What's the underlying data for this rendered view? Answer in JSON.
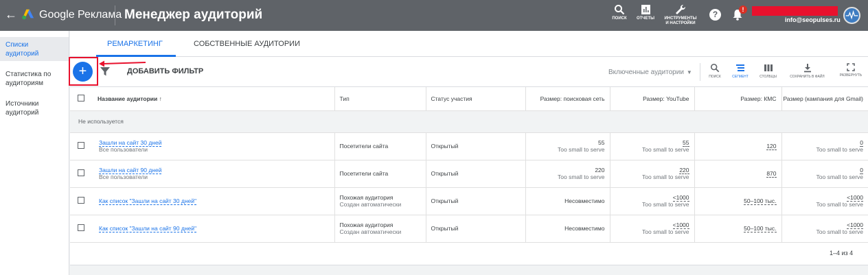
{
  "header": {
    "back_icon": "arrow-left-icon",
    "brand": "Google Реклама",
    "page_title": "Менеджер аудиторий",
    "search_label": "ПОИСК",
    "reports_label": "ОТЧЕТЫ",
    "tools_label_1": "ИНСТРУМЕНТЫ",
    "tools_label_2": "И НАСТРОЙКИ",
    "help_glyph": "?",
    "notification_badge": "!",
    "email": "info@seopulses.ru"
  },
  "sidebar": {
    "items": [
      {
        "label": "Списки аудиторий",
        "active": true
      },
      {
        "label": "Статистика по аудиториям",
        "active": false
      },
      {
        "label": "Источники аудиторий",
        "active": false
      }
    ]
  },
  "tabs": [
    {
      "label": "РЕМАРКЕТИНГ",
      "active": true
    },
    {
      "label": "СОБСТВЕННЫЕ АУДИТОРИИ",
      "active": false
    }
  ],
  "toolbar": {
    "add_glyph": "+",
    "add_filter": "ДОБАВИТЬ ФИЛЬТР",
    "included": "Включенные аудитории",
    "tools": {
      "search": "ПОИСК",
      "segment": "СЕГМЕНТ",
      "columns": "СТОЛБЦЫ",
      "save": "СОХРАНИТЬ В ФАЙЛ",
      "expand": "РАЗВЕРНУТЬ"
    }
  },
  "table": {
    "headers": {
      "name": "Название аудитории",
      "type": "Тип",
      "status": "Статус участия",
      "search": "Размер: поисковая сеть",
      "youtube": "Размер: YouTube",
      "kms": "Размер: КМС",
      "gmail": "Размер (кампания для Gmail)"
    },
    "group": "Не используется",
    "rows": [
      {
        "name": "Зашли на сайт 30 дней",
        "sub": "Все пользователи",
        "type": "Посетители сайта",
        "type_sub": "",
        "status": "Открытый",
        "search_val": "55",
        "search_sub": "Too small to serve",
        "yt_val": "55",
        "yt_sub": "Too small to serve",
        "kms_val": "120",
        "gmail_val": "0",
        "gmail_sub": "Too small to serve"
      },
      {
        "name": "Зашли на сайт 90 дней",
        "sub": "Все пользователи",
        "type": "Посетители сайта",
        "type_sub": "",
        "status": "Открытый",
        "search_val": "220",
        "search_sub": "Too small to serve",
        "yt_val": "220",
        "yt_sub": "Too small to serve",
        "kms_val": "870",
        "gmail_val": "0",
        "gmail_sub": "Too small to serve"
      },
      {
        "name": "Как список \"Зашли на сайт 30 дней\"",
        "sub": "",
        "type": "Похожая аудитория",
        "type_sub": "Создан автоматически",
        "status": "Открытый",
        "search_val": "Несовместимо",
        "search_sub": "",
        "yt_val": "<1000",
        "yt_sub": "Too small to serve",
        "kms_val": "50–100 тыс.",
        "gmail_val": "<1000",
        "gmail_sub": "Too small to serve"
      },
      {
        "name": "Как список \"Зашли на сайт 90 дней\"",
        "sub": "",
        "type": "Похожая аудитория",
        "type_sub": "Создан автоматически",
        "status": "Открытый",
        "search_val": "Несовместимо",
        "search_sub": "",
        "yt_val": "<1000",
        "yt_sub": "Too small to serve",
        "kms_val": "50–100 тыс.",
        "gmail_val": "<1000",
        "gmail_sub": "Too small to serve"
      }
    ]
  },
  "pager": "1–4 из 4",
  "colors": {
    "topbar": "#5f6368",
    "accent": "#1a73e8",
    "highlight": "#e8112d"
  }
}
